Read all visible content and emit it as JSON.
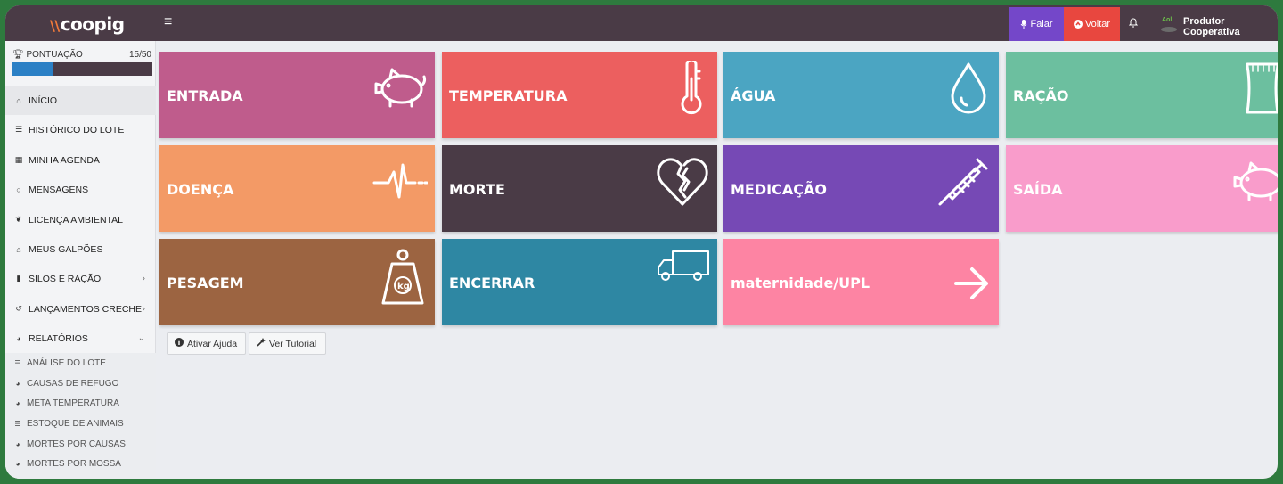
{
  "app": {
    "logo_mark": "\\\\",
    "logo_text": "coopig"
  },
  "topbar": {
    "menu_icon": "hamburger-icon",
    "falar_label": "Falar",
    "voltar_label": "Voltar",
    "user_name": "Produtor Cooperativa",
    "avatar_text": "Aol"
  },
  "score": {
    "label": "PONTUAÇÃO",
    "value": "15/50",
    "current": 15,
    "max": 50
  },
  "nav": [
    {
      "label": "INÍCIO",
      "icon": "home-icon"
    },
    {
      "label": "HISTÓRICO DO LOTE",
      "icon": "list-icon"
    },
    {
      "label": "MINHA AGENDA",
      "icon": "calendar-icon"
    },
    {
      "label": "MENSAGENS",
      "icon": "chat-icon"
    },
    {
      "label": "LICENÇA AMBIENTAL",
      "icon": "leaf-icon"
    },
    {
      "label": "MEUS GALPÕES",
      "icon": "barn-icon"
    },
    {
      "label": "SILOS E RAÇÃO",
      "icon": "silo-icon"
    },
    {
      "label": "LANÇAMENTOS CRECHE",
      "icon": "refresh-icon"
    },
    {
      "label": "RELATÓRIOS",
      "icon": "pie-chart-icon"
    }
  ],
  "reports": [
    {
      "label": "ANÁLISE DO LOTE",
      "icon": "list-icon"
    },
    {
      "label": "CAUSAS DE REFUGO",
      "icon": "pie-chart-icon"
    },
    {
      "label": "META TEMPERATURA",
      "icon": "pie-chart-icon"
    },
    {
      "label": "ESTOQUE DE ANIMAIS",
      "icon": "list-icon"
    },
    {
      "label": "MORTES POR CAUSAS",
      "icon": "pie-chart-icon"
    },
    {
      "label": "MORTES POR MOSSA",
      "icon": "pie-chart-icon"
    }
  ],
  "tiles": [
    {
      "label": "ENTRADA",
      "icon": "piggy-bank-icon",
      "color": "#bf5c8c"
    },
    {
      "label": "TEMPERATURA",
      "icon": "thermometer-icon",
      "color": "#ec5f5f"
    },
    {
      "label": "ÁGUA",
      "icon": "water-drop-icon",
      "color": "#4ba5c2"
    },
    {
      "label": "RAÇÃO",
      "icon": "feed-bag-icon",
      "color": "#6cbf9f"
    },
    {
      "label": "DOENÇA",
      "icon": "heartbeat-icon",
      "color": "#f39a66"
    },
    {
      "label": "MORTE",
      "icon": "broken-heart-icon",
      "color": "#4a3b46"
    },
    {
      "label": "MEDICAÇÃO",
      "icon": "syringe-icon",
      "color": "#7649b5"
    },
    {
      "label": "SAÍDA",
      "icon": "piggy-bank-icon",
      "color": "#f99ccb"
    },
    {
      "label": "PESAGEM",
      "icon": "weight-icon",
      "color": "#9c6441"
    },
    {
      "label": "ENCERRAR",
      "icon": "truck-icon",
      "color": "#2e87a3"
    },
    {
      "label": "maternidade/UPL",
      "icon": "arrow-right-icon",
      "color": "#fd84a3"
    }
  ],
  "actions": {
    "help_label": "Ativar Ajuda",
    "tutorial_label": "Ver Tutorial"
  }
}
